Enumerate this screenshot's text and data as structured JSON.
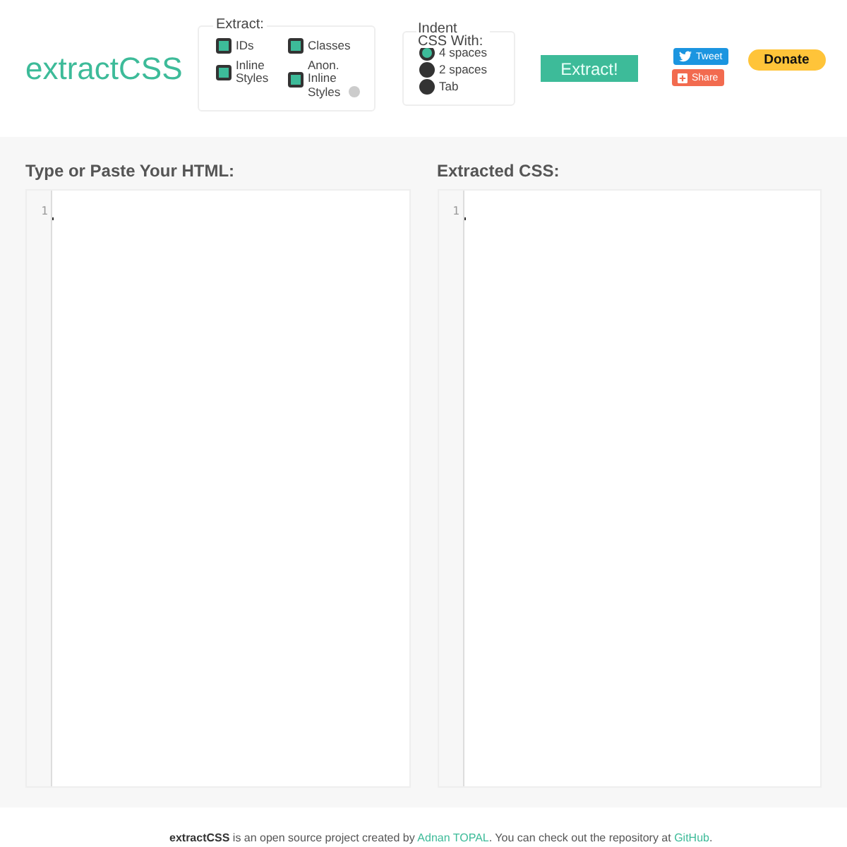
{
  "logo": "extractCSS",
  "extract": {
    "legend": "Extract:",
    "options": [
      {
        "label": "IDs",
        "checked": true
      },
      {
        "label": "Classes",
        "checked": true
      },
      {
        "label": "Inline Styles",
        "checked": true
      },
      {
        "label": "Anon. Inline Styles",
        "checked": true,
        "info": true
      }
    ]
  },
  "indent": {
    "legend": "Indent CSS With:",
    "options": [
      {
        "label": "4 spaces",
        "selected": true
      },
      {
        "label": "2 spaces",
        "selected": false
      },
      {
        "label": "Tab",
        "selected": false
      }
    ]
  },
  "extract_button": "Extract!",
  "social": {
    "tweet": "Tweet",
    "share": "Share",
    "donate": "Donate"
  },
  "editors": [
    {
      "title": "Type or Paste Your HTML:",
      "line": "1"
    },
    {
      "title": "Extracted CSS:",
      "line": "1"
    }
  ],
  "footer": [
    {
      "kind": "bold",
      "text": "extractCSS"
    },
    {
      "kind": "text",
      "text": " is an open source project created by "
    },
    {
      "kind": "link",
      "text": "Adnan TOPAL"
    },
    {
      "kind": "text",
      "text": ". You can check out the repository at "
    },
    {
      "kind": "link",
      "text": "GitHub"
    },
    {
      "kind": "text",
      "text": "."
    }
  ]
}
